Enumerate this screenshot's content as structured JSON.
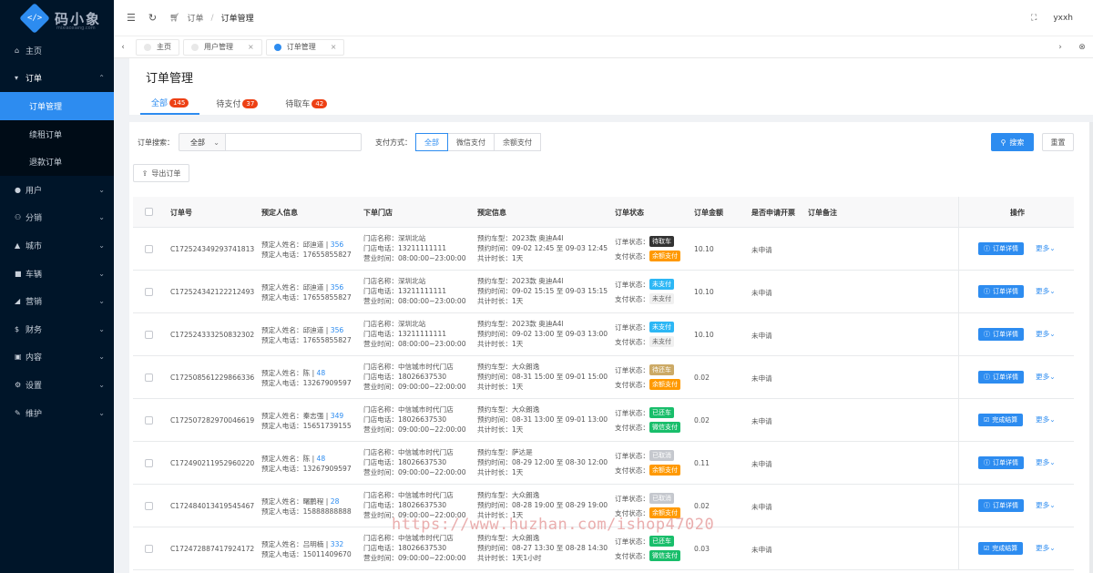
{
  "logo": {
    "text": "码小象",
    "sub": "mixiaoxiang.com"
  },
  "sidebar": {
    "items": [
      {
        "icon": "home-icon",
        "glyph": "⌂",
        "label": "主页"
      },
      {
        "icon": "cart-icon",
        "glyph": "▾",
        "label": "订单",
        "open": true
      },
      {
        "icon": "user-icon",
        "glyph": "●",
        "label": "用户"
      },
      {
        "icon": "distribution-icon",
        "glyph": "⚇",
        "label": "分销"
      },
      {
        "icon": "city-icon",
        "glyph": "▲",
        "label": "城市"
      },
      {
        "icon": "car-icon",
        "glyph": "■",
        "label": "车辆"
      },
      {
        "icon": "marketing-icon",
        "glyph": "◢",
        "label": "营销"
      },
      {
        "icon": "finance-icon",
        "glyph": "$",
        "label": "财务"
      },
      {
        "icon": "content-icon",
        "glyph": "▣",
        "label": "内容"
      },
      {
        "icon": "settings-icon",
        "glyph": "⚙",
        "label": "设置"
      },
      {
        "icon": "maintain-icon",
        "glyph": "✎",
        "label": "维护"
      }
    ],
    "subitems": [
      "订单管理",
      "续租订单",
      "退款订单"
    ]
  },
  "header": {
    "breadcrumb": [
      "订单",
      "订单管理"
    ],
    "user": "yxxh"
  },
  "tabs": [
    {
      "label": "主页",
      "closable": false
    },
    {
      "label": "用户管理",
      "closable": true
    },
    {
      "label": "订单管理",
      "closable": true,
      "active": true
    }
  ],
  "page": {
    "title": "订单管理",
    "tabs": [
      {
        "label": "全部",
        "count": "145",
        "active": true
      },
      {
        "label": "待支付",
        "count": "37"
      },
      {
        "label": "待取车",
        "count": "42"
      }
    ]
  },
  "filter": {
    "search_label": "订单搜索：",
    "select_value": "全部",
    "pay_label": "支付方式：",
    "pay_options": [
      "全部",
      "微信支付",
      "余额支付"
    ],
    "search_btn": "搜索",
    "reset_btn": "重置",
    "export_btn": "导出订单"
  },
  "table": {
    "headers": {
      "order_no": "订单号",
      "booker": "预定人信息",
      "store": "下单门店",
      "booking": "预定信息",
      "status": "订单状态",
      "amount": "订单金额",
      "invoice": "是否申请开票",
      "remark": "订单备注",
      "ops": "操作"
    },
    "rows": [
      {
        "order_no": "C172524349293741813",
        "name_label": "预定人姓名：",
        "name": "邱迪道",
        "uid": "356",
        "phone_label": "预定人电话：",
        "phone": "17655855827",
        "store_name": "门店名称：深圳北站",
        "store_phone": "门店电话：13211111111",
        "store_hours": "营业时间：08:00:00~23:00:00",
        "car": "预约车型：2023款 奥迪A4l",
        "time": "预约时间：09-02 12:45 至 09-03 12:45",
        "dur": "共计时长：1天",
        "order_status_label": "订单状态：",
        "order_status": "待取车",
        "order_cls": "p-dark",
        "pay_status_label": "支付状态：",
        "pay_status": "余额支付",
        "pay_cls": "p-orange",
        "amount": "10.10",
        "invoice": "未申请",
        "op": "订单详情",
        "op_icon": "info-icon",
        "more": "更多"
      },
      {
        "order_no": "C172524342122212493",
        "name_label": "预定人姓名：",
        "name": "邱迪道",
        "uid": "356",
        "phone_label": "预定人电话：",
        "phone": "17655855827",
        "store_name": "门店名称：深圳北站",
        "store_phone": "门店电话：13211111111",
        "store_hours": "营业时间：08:00:00~23:00:00",
        "car": "预约车型：2023款 奥迪A4l",
        "time": "预约时间：09-02 15:15 至 09-03 15:15",
        "dur": "共计时长：1天",
        "order_status_label": "订单状态：",
        "order_status": "未支付",
        "order_cls": "p-blue",
        "pay_status_label": "支付状态：",
        "pay_status": "未支付",
        "pay_cls": "p-gray",
        "amount": "10.10",
        "invoice": "未申请",
        "op": "订单详情",
        "op_icon": "info-icon",
        "more": "更多"
      },
      {
        "order_no": "C172524333250832302",
        "name_label": "预定人姓名：",
        "name": "邱迪道",
        "uid": "356",
        "phone_label": "预定人电话：",
        "phone": "17655855827",
        "store_name": "门店名称：深圳北站",
        "store_phone": "门店电话：13211111111",
        "store_hours": "营业时间：08:00:00~23:00:00",
        "car": "预约车型：2023款 奥迪A4l",
        "time": "预约时间：09-02 13:00 至 09-03 13:00",
        "dur": "共计时长：1天",
        "order_status_label": "订单状态：",
        "order_status": "未支付",
        "order_cls": "p-blue",
        "pay_status_label": "支付状态：",
        "pay_status": "未支付",
        "pay_cls": "p-gray",
        "amount": "10.10",
        "invoice": "未申请",
        "op": "订单详情",
        "op_icon": "info-icon",
        "more": "更多"
      },
      {
        "order_no": "C172508561229866336",
        "name_label": "预定人姓名：",
        "name": "陈",
        "uid": "48",
        "phone_label": "预定人电话：",
        "phone": "13267909597",
        "store_name": "门店名称：中信城市时代门店",
        "store_phone": "门店电话：18026637530",
        "store_hours": "营业时间：09:00:00~22:00:00",
        "car": "预约车型：大众朗逸",
        "time": "预约时间：08-31 15:00 至 09-01 15:00",
        "dur": "共计时长：1天",
        "order_status_label": "订单状态：",
        "order_status": "待还车",
        "order_cls": "p-yellowish",
        "pay_status_label": "支付状态：",
        "pay_status": "余额支付",
        "pay_cls": "p-orange",
        "amount": "0.02",
        "invoice": "未申请",
        "op": "订单详情",
        "op_icon": "info-icon",
        "more": "更多"
      },
      {
        "order_no": "C172507282970046619",
        "name_label": "预定人姓名：",
        "name": "秦志强",
        "uid": "349",
        "phone_label": "预定人电话：",
        "phone": "15651739155",
        "store_name": "门店名称：中信城市时代门店",
        "store_phone": "门店电话：18026637530",
        "store_hours": "营业时间：09:00:00~22:00:00",
        "car": "预约车型：大众朗逸",
        "time": "预约时间：08-31 13:00 至 09-01 13:00",
        "dur": "共计时长：1天",
        "order_status_label": "订单状态：",
        "order_status": "已还车",
        "order_cls": "p-green",
        "pay_status_label": "支付状态：",
        "pay_status": "微信支付",
        "pay_cls": "p-green",
        "amount": "0.02",
        "invoice": "未申请",
        "op": "完成结算",
        "op_icon": "check-icon",
        "more": "更多"
      },
      {
        "order_no": "C172490211952960220",
        "name_label": "预定人姓名：",
        "name": "陈",
        "uid": "48",
        "phone_label": "预定人电话：",
        "phone": "13267909597",
        "store_name": "门店名称：中信城市时代门店",
        "store_phone": "门店电话：18026637530",
        "store_hours": "营业时间：09:00:00~22:00:00",
        "car": "预约车型：萨达是",
        "time": "预约时间：08-29 12:00 至 08-30 12:00",
        "dur": "共计时长：1天",
        "order_status_label": "订单状态：",
        "order_status": "已取消",
        "order_cls": "p-lgray",
        "pay_status_label": "支付状态：",
        "pay_status": "余额支付",
        "pay_cls": "p-orange",
        "amount": "0.11",
        "invoice": "未申请",
        "op": "订单详情",
        "op_icon": "info-icon",
        "more": "更多"
      },
      {
        "order_no": "C172484013419545467",
        "name_label": "预定人姓名：",
        "name": "曙鹏程",
        "uid": "28",
        "phone_label": "预定人电话：",
        "phone": "15888888888",
        "store_name": "门店名称：中信城市时代门店",
        "store_phone": "门店电话：18026637530",
        "store_hours": "营业时间：09:00:00~22:00:00",
        "car": "预约车型：大众朗逸",
        "time": "预约时间：08-28 19:00 至 08-29 19:00",
        "dur": "共计时长：1天",
        "order_status_label": "订单状态：",
        "order_status": "已取消",
        "order_cls": "p-lgray",
        "pay_status_label": "支付状态：",
        "pay_status": "余额支付",
        "pay_cls": "p-orange",
        "amount": "0.02",
        "invoice": "未申请",
        "op": "订单详情",
        "op_icon": "info-icon",
        "more": "更多"
      },
      {
        "order_no": "C172472887417924172",
        "name_label": "预定人姓名：",
        "name": "吕明楠",
        "uid": "332",
        "phone_label": "预定人电话：",
        "phone": "15011409670",
        "store_name": "门店名称：中信城市时代门店",
        "store_phone": "门店电话：18026637530",
        "store_hours": "营业时间：09:00:00~22:00:00",
        "car": "预约车型：大众朗逸",
        "time": "预约时间：08-27 13:30 至 08-28 14:30",
        "dur": "共计时长：1天1小时",
        "order_status_label": "订单状态：",
        "order_status": "已还车",
        "order_cls": "p-green",
        "pay_status_label": "支付状态：",
        "pay_status": "微信支付",
        "pay_cls": "p-green",
        "amount": "0.03",
        "invoice": "未申请",
        "op": "完成结算",
        "op_icon": "check-icon",
        "more": "更多"
      }
    ]
  },
  "watermark": "https://www.huzhan.com/ishop47020"
}
